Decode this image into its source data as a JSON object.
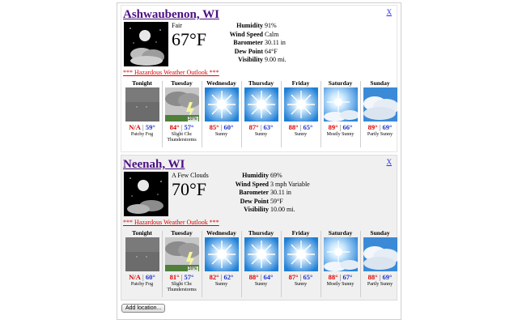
{
  "locations": [
    {
      "name": "Ashwaubenon, WI",
      "close": "X",
      "condition": "Fair",
      "temp": "67°F",
      "details": [
        {
          "label": "Humidity",
          "value": "91%"
        },
        {
          "label": "Wind Speed",
          "value": "Calm"
        },
        {
          "label": "Barometer",
          "value": "30.11 in"
        },
        {
          "label": "Dew Point",
          "value": "64°F"
        },
        {
          "label": "Visibility",
          "value": "9.00 mi."
        }
      ],
      "outlook": "*** Hazardous Weather Outlook ***",
      "forecast": [
        {
          "day": "Tonight",
          "hi": "N/A",
          "lo": "59°",
          "desc": "Patchy Fog",
          "icon": "fog-icon",
          "pct": ""
        },
        {
          "day": "Tuesday",
          "hi": "84°",
          "lo": "57°",
          "desc": "Slight Chc Thunderstorms",
          "icon": "thunderstorm-icon",
          "pct": "20%"
        },
        {
          "day": "Wednesday",
          "hi": "85°",
          "lo": "60°",
          "desc": "Sunny",
          "icon": "sun-icon",
          "pct": ""
        },
        {
          "day": "Thursday",
          "hi": "87°",
          "lo": "63°",
          "desc": "Sunny",
          "icon": "sun-icon",
          "pct": ""
        },
        {
          "day": "Friday",
          "hi": "88°",
          "lo": "65°",
          "desc": "Sunny",
          "icon": "sun-icon",
          "pct": ""
        },
        {
          "day": "Saturday",
          "hi": "89°",
          "lo": "66°",
          "desc": "Mostly Sunny",
          "icon": "mostly-sunny-icon",
          "pct": ""
        },
        {
          "day": "Sunday",
          "hi": "89°",
          "lo": "69°",
          "desc": "Partly Sunny",
          "icon": "partly-sunny-icon",
          "pct": ""
        }
      ]
    },
    {
      "name": "Neenah, WI",
      "close": "X",
      "condition": "A Few Clouds",
      "temp": "70°F",
      "details": [
        {
          "label": "Humidity",
          "value": "69%"
        },
        {
          "label": "Wind Speed",
          "value": "3 mph Variable"
        },
        {
          "label": "Barometer",
          "value": "30.11 in"
        },
        {
          "label": "Dew Point",
          "value": "59°F"
        },
        {
          "label": "Visibility",
          "value": "10.00 mi."
        }
      ],
      "outlook": "*** Hazardous Weather Outlook ***",
      "forecast": [
        {
          "day": "Tonight",
          "hi": "N/A",
          "lo": "60°",
          "desc": "Patchy Fog",
          "icon": "fog-icon",
          "pct": ""
        },
        {
          "day": "Tuesday",
          "hi": "81°",
          "lo": "57°",
          "desc": "Slight Chc Thunderstorms",
          "icon": "thunderstorm-icon",
          "pct": "20%"
        },
        {
          "day": "Wednesday",
          "hi": "82°",
          "lo": "62°",
          "desc": "Sunny",
          "icon": "sun-icon",
          "pct": ""
        },
        {
          "day": "Thursday",
          "hi": "88°",
          "lo": "64°",
          "desc": "Sunny",
          "icon": "sun-icon",
          "pct": ""
        },
        {
          "day": "Friday",
          "hi": "87°",
          "lo": "65°",
          "desc": "Sunny",
          "icon": "sun-icon",
          "pct": ""
        },
        {
          "day": "Saturday",
          "hi": "88°",
          "lo": "67°",
          "desc": "Mostly Sunny",
          "icon": "mostly-sunny-icon",
          "pct": ""
        },
        {
          "day": "Sunday",
          "hi": "88°",
          "lo": "69°",
          "desc": "Partly Sunny",
          "icon": "partly-sunny-icon",
          "pct": ""
        }
      ]
    }
  ],
  "add_location": "Add location..."
}
